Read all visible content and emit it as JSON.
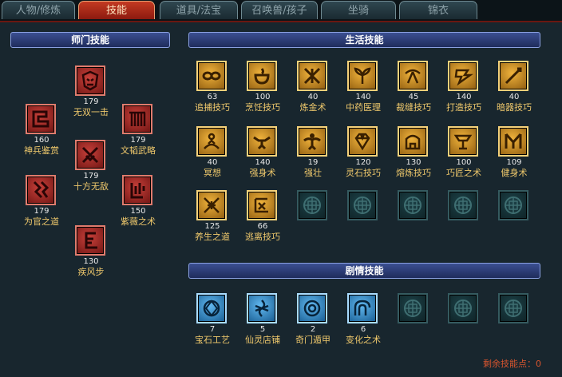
{
  "tabs": [
    {
      "label": "人物/修炼",
      "active": false
    },
    {
      "label": "技能",
      "active": true
    },
    {
      "label": "道具/法宝",
      "active": false
    },
    {
      "label": "召唤兽/孩子",
      "active": false
    },
    {
      "label": "坐骑",
      "active": false
    },
    {
      "label": "锦衣",
      "active": false
    }
  ],
  "sections": {
    "school": "师门技能",
    "life": "生活技能",
    "story": "剧情技能"
  },
  "school_skills": [
    {
      "level": "179",
      "name": "无双一击"
    },
    {
      "level": "160",
      "name": "神兵鉴赏"
    },
    {
      "level": "179",
      "name": "文韬武略"
    },
    {
      "level": "179",
      "name": "十方无敌"
    },
    {
      "level": "179",
      "name": "为官之道"
    },
    {
      "level": "150",
      "name": "紫薇之术"
    },
    {
      "level": "130",
      "name": "疾风步"
    }
  ],
  "life_skills": [
    {
      "level": "63",
      "name": "追捕技巧"
    },
    {
      "level": "100",
      "name": "烹饪技巧"
    },
    {
      "level": "40",
      "name": "炼金术"
    },
    {
      "level": "140",
      "name": "中药医理"
    },
    {
      "level": "45",
      "name": "裁缝技巧"
    },
    {
      "level": "140",
      "name": "打造技巧"
    },
    {
      "level": "40",
      "name": "暗器技巧"
    },
    {
      "level": "40",
      "name": "冥想"
    },
    {
      "level": "140",
      "name": "强身术"
    },
    {
      "level": "19",
      "name": "强壮"
    },
    {
      "level": "120",
      "name": "灵石技巧"
    },
    {
      "level": "130",
      "name": "熔炼技巧"
    },
    {
      "level": "100",
      "name": "巧匠之术"
    },
    {
      "level": "109",
      "name": "健身术"
    },
    {
      "level": "125",
      "name": "养生之道"
    },
    {
      "level": "66",
      "name": "逃离技巧"
    }
  ],
  "story_skills": [
    {
      "level": "7",
      "name": "宝石工艺"
    },
    {
      "level": "5",
      "name": "仙灵店铺"
    },
    {
      "level": "2",
      "name": "奇门遁甲"
    },
    {
      "level": "6",
      "name": "变化之术"
    }
  ],
  "remaining_points": "剩余技能点：0",
  "colors": {
    "school": "#c7403a",
    "life": "#f0b33c",
    "story": "#62b8ef",
    "empty": "#1d4248",
    "name_text": "#f0c96c"
  }
}
